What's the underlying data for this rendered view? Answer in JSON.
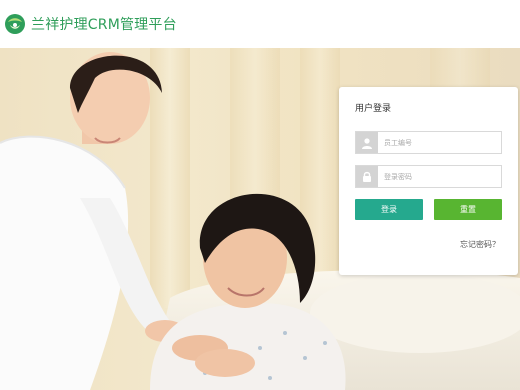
{
  "header": {
    "title": "兰祥护理CRM管理平台",
    "logo_icon": "leaf-heart-logo",
    "title_color": "#2f9e5a"
  },
  "banner": {
    "image": "nurse-and-elderly-patient-photo"
  },
  "login": {
    "title": "用户登录",
    "employee_id_placeholder": "员工编号",
    "password_placeholder": "登录密码",
    "employee_id_icon": "user-icon",
    "password_icon": "lock-icon",
    "login_label": "登录",
    "reset_label": "重置",
    "forgot_label": "忘记密码？",
    "login_color": "#25a98e",
    "reset_color": "#58b531"
  }
}
